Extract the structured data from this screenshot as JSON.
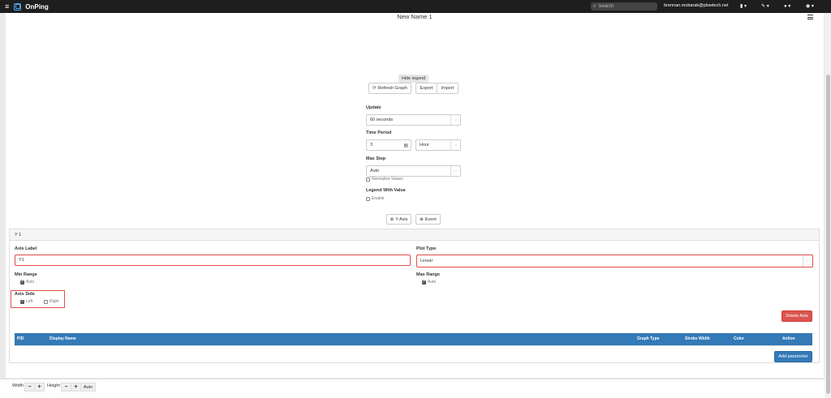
{
  "topbar": {
    "brand": "OnPing",
    "search_placeholder": "Search",
    "user_email": "brennan.mobarak@plowtech.net",
    "bookmark_caret": "▾",
    "tools_caret": "▾",
    "account_caret": "▾",
    "help_caret": "▾"
  },
  "page": {
    "title": "New Name 1",
    "hide_legend": "Hide legend",
    "refresh_label": "Refresh Graph",
    "export_label": "Export",
    "import_label": "Import"
  },
  "settings": {
    "update_label": "Update",
    "update_value": "60 seconds",
    "time_period_label": "Time Period",
    "time_period_value": "3",
    "time_period_unit": "Hour",
    "max_step_label": "Max Step",
    "max_step_value": "Auto",
    "normalize_label": "Normalize Values",
    "normalize_checked": false,
    "legend_value_label": "Legend With Value",
    "enable_label": "Enable",
    "enable_checked": false,
    "y_axis_button": "Y Axis",
    "event_button": "Event"
  },
  "axis_panel": {
    "heading": "Y 1",
    "axis_label_label": "Axis Label",
    "axis_label_value": "Y1",
    "plot_type_label": "Plot Type",
    "plot_type_value": "Linear",
    "min_range_label": "Min Range",
    "min_auto_label": "Auto",
    "max_range_label": "Max Range",
    "max_auto_label": "Auto",
    "axis_side_label": "Axis Side",
    "left_label": "Left",
    "right_label": "Right",
    "delete_axis": "Delete Axis",
    "add_parameter": "Add parameter",
    "table_headers": {
      "pid": "PID",
      "display_name": "Display Name",
      "graph_type": "Graph Type",
      "stroke_width": "Stroke Width",
      "color": "Color",
      "action": "Action"
    }
  },
  "bottombar": {
    "width_label": "Width",
    "height_label": "Height",
    "minus": "−",
    "plus": "+",
    "auto_label": "Auto"
  },
  "colors": {
    "accent": "#337ab7",
    "danger": "#d9534f",
    "highlight": "#e34b4b"
  }
}
